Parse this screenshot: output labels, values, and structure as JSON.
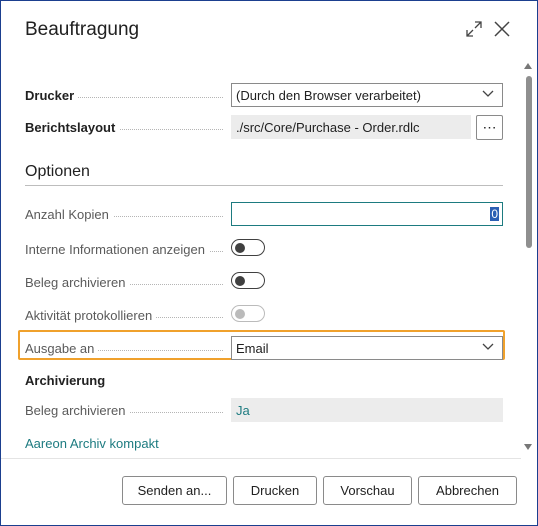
{
  "dialog": {
    "title": "Beauftragung",
    "expand_icon": "expand-icon",
    "close_icon": "close-icon"
  },
  "printer": {
    "label": "Drucker",
    "value": "(Durch den Browser verarbeitet)"
  },
  "report_layout": {
    "label": "Berichtslayout",
    "value": "./src/Core/Purchase - Order.rdlc",
    "more_label": "⋯"
  },
  "options": {
    "heading": "Optionen",
    "copies": {
      "label": "Anzahl Kopien",
      "value": "0"
    },
    "internal_info": {
      "label": "Interne Informationen anzeigen",
      "on": false
    },
    "archive_doc": {
      "label": "Beleg archivieren",
      "on": false
    },
    "log_activity": {
      "label": "Aktivität protokollieren",
      "on": false,
      "disabled": true
    },
    "output_to": {
      "label": "Ausgabe an",
      "value": "Email"
    }
  },
  "archiving": {
    "heading": "Archivierung",
    "archive_doc": {
      "label": "Beleg archivieren",
      "value": "Ja"
    },
    "link": "Aareon Archiv kompakt"
  },
  "buttons": {
    "send_to": "Senden an...",
    "print": "Drucken",
    "preview": "Vorschau",
    "cancel": "Abbrechen"
  },
  "colors": {
    "accent": "#1d7b80",
    "focus": "#f0a12c",
    "border": "#1b3f8f"
  }
}
